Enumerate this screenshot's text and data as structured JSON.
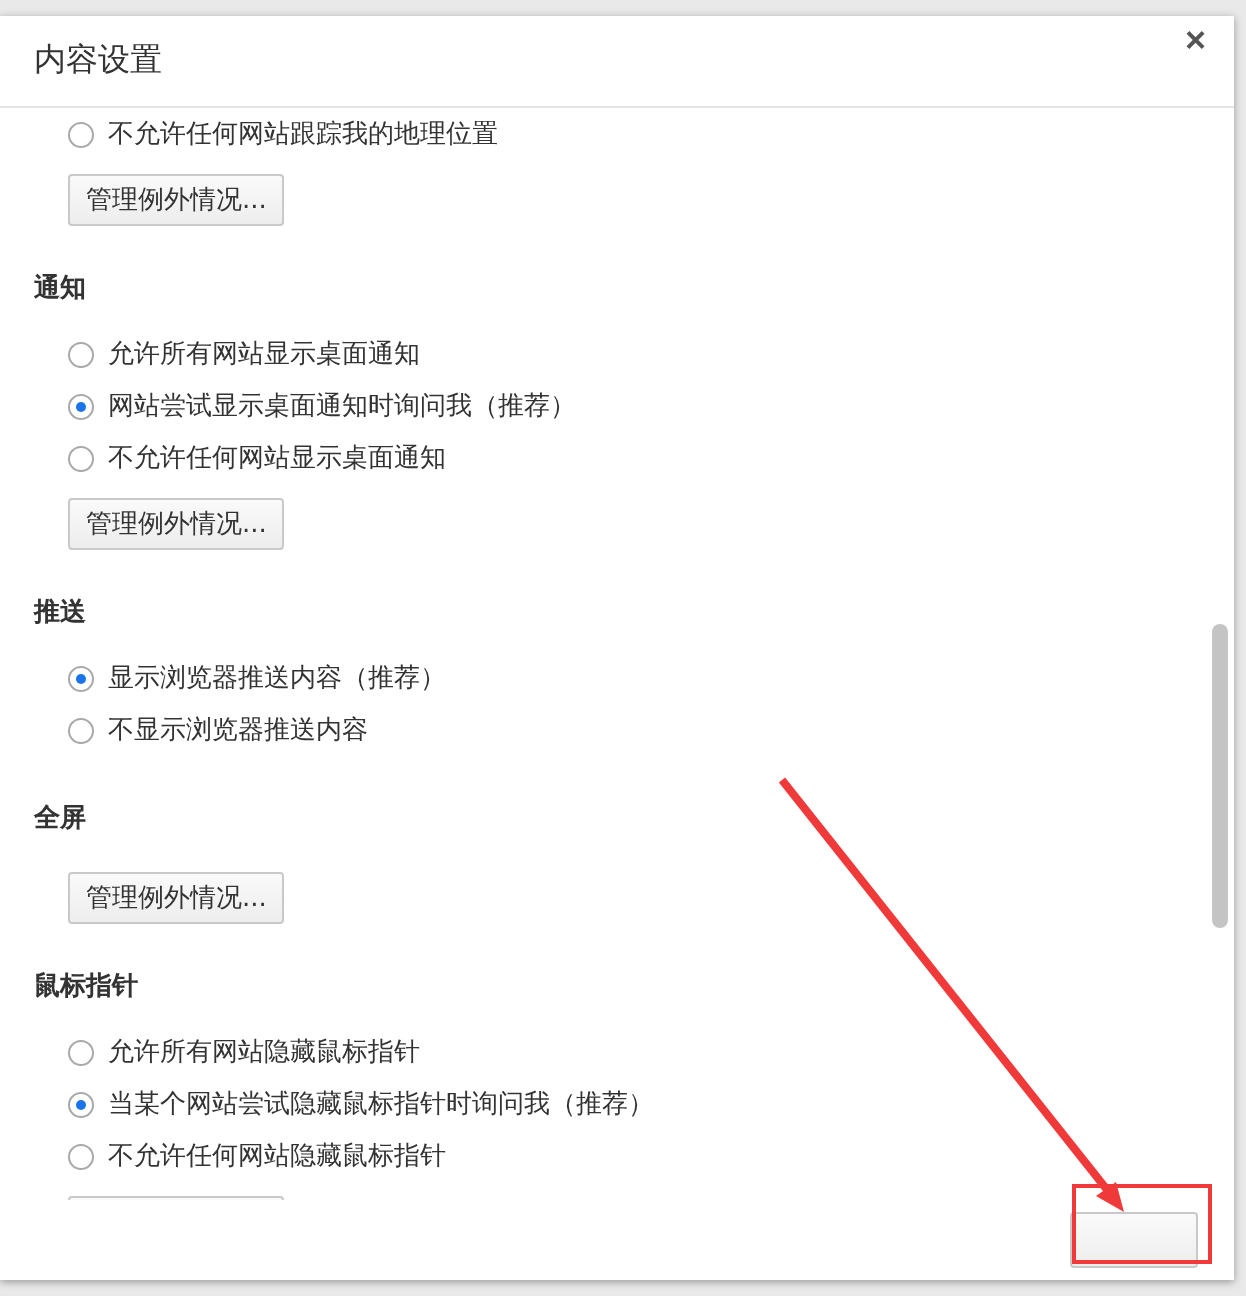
{
  "dialog": {
    "title": "内容设置",
    "close": "×"
  },
  "sections": [
    {
      "items": [
        {
          "kind": "radio",
          "label": "不允许任何网站跟踪我的地理位置",
          "selected": false
        },
        {
          "kind": "button",
          "label": "管理例外情况..."
        }
      ]
    },
    {
      "heading": "通知",
      "items": [
        {
          "kind": "radio",
          "label": "允许所有网站显示桌面通知",
          "selected": false
        },
        {
          "kind": "radio",
          "label": "网站尝试显示桌面通知时询问我（推荐）",
          "selected": true
        },
        {
          "kind": "radio",
          "label": "不允许任何网站显示桌面通知",
          "selected": false
        },
        {
          "kind": "button",
          "label": "管理例外情况..."
        }
      ]
    },
    {
      "heading": "推送",
      "items": [
        {
          "kind": "radio",
          "label": "显示浏览器推送内容（推荐）",
          "selected": true
        },
        {
          "kind": "radio",
          "label": "不显示浏览器推送内容",
          "selected": false
        }
      ]
    },
    {
      "heading": "全屏",
      "items": [
        {
          "kind": "button",
          "label": "管理例外情况..."
        }
      ]
    },
    {
      "heading": "鼠标指针",
      "items": [
        {
          "kind": "radio",
          "label": "允许所有网站隐藏鼠标指针",
          "selected": false
        },
        {
          "kind": "radio",
          "label": "当某个网站尝试隐藏鼠标指针时询问我（推荐）",
          "selected": true
        },
        {
          "kind": "radio",
          "label": "不允许任何网站隐藏鼠标指针",
          "selected": false
        },
        {
          "kind": "button"
        }
      ]
    }
  ]
}
